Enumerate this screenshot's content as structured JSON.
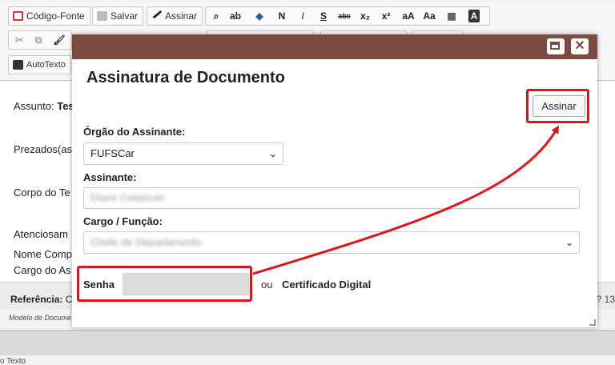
{
  "toolbar": {
    "row1": {
      "source_code_label": "Código-Fonte",
      "save_label": "Salvar",
      "sign_label": "Assinar"
    },
    "row3": {
      "autotext_label": "AutoTexto"
    }
  },
  "document": {
    "subject_label": "Assunto:",
    "subject_value": "Tes",
    "greeting": "Prezados(as",
    "body": "Corpo do Te",
    "closing": "Atenciosam",
    "name": "Nome Comp",
    "role": "Cargo do As",
    "reference_label": "Referência:",
    "reference_value": "C",
    "reference_right": "? 13",
    "model_text": "Modelo de Docume",
    "bottom_text": "o Texto"
  },
  "modal": {
    "title": "Assinatura de Documento",
    "sign_button": "Assinar",
    "org_label": "Órgão do Assinante:",
    "org_value": "FUFSCar",
    "signer_label": "Assinante:",
    "signer_value": "Eliane Colepicolo",
    "role_label": "Cargo / Função:",
    "role_value": "Chefe de Departamento",
    "password_label": "Senha",
    "or_text": "ou",
    "certificate_label": "Certificado Digital"
  },
  "colors": {
    "modal_header": "#7b4a40",
    "highlight": "#e0151b"
  }
}
